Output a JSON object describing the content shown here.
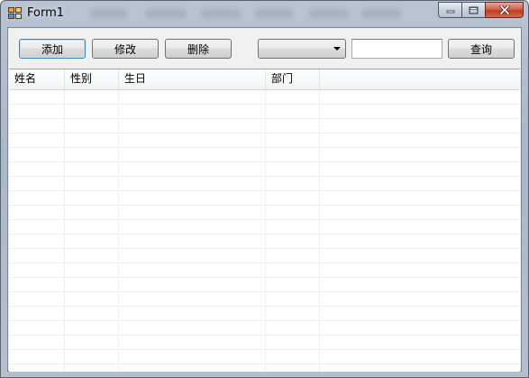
{
  "window": {
    "title": "Form1"
  },
  "toolbar": {
    "add_label": "添加",
    "edit_label": "修改",
    "delete_label": "删除",
    "category_value": "",
    "search_value": "",
    "query_label": "查询"
  },
  "grid": {
    "columns": [
      {
        "label": "姓名"
      },
      {
        "label": "性别"
      },
      {
        "label": "生日"
      },
      {
        "label": "部门"
      }
    ],
    "rows": []
  }
}
